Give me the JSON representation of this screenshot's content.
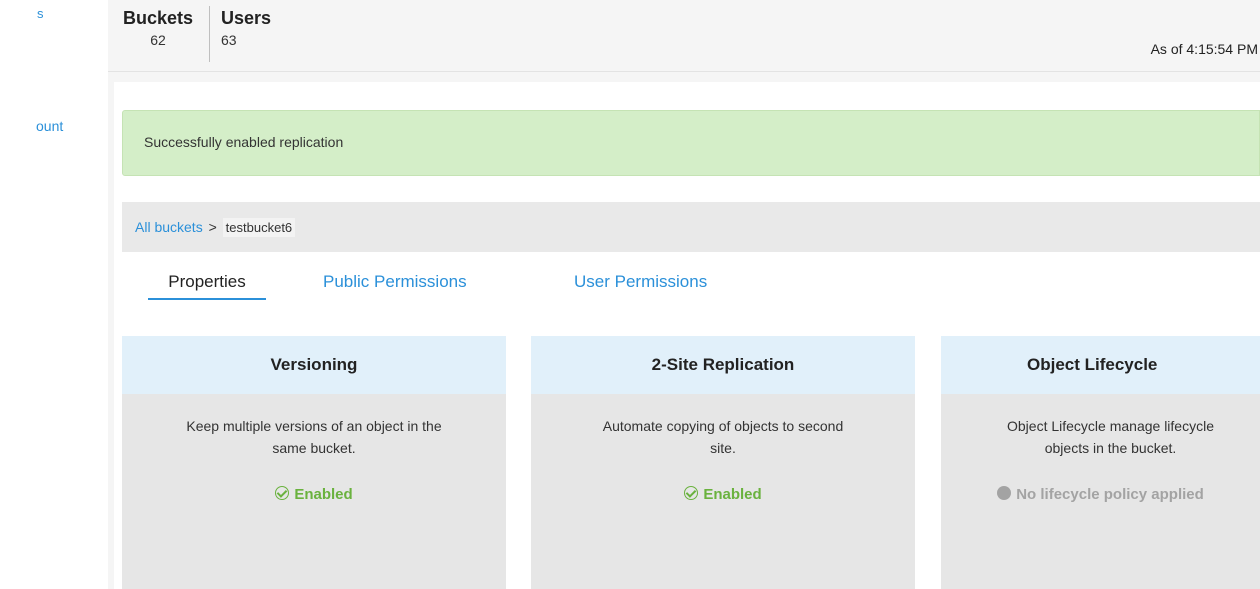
{
  "sidebar": {
    "top_link": "s",
    "account_link": "ount"
  },
  "stats": {
    "buckets_label": "Buckets",
    "buckets_value": "62",
    "users_label": "Users",
    "users_value": "63",
    "as_of": "As of 4:15:54 PM"
  },
  "alert": {
    "message": "Successfully enabled replication"
  },
  "breadcrumb": {
    "root": "All buckets",
    "separator": ">",
    "current": "testbucket6"
  },
  "tabs": [
    {
      "label": "Properties",
      "active": true
    },
    {
      "label": "Public Permissions",
      "active": false
    },
    {
      "label": "User Permissions",
      "active": false
    }
  ],
  "cards": [
    {
      "title": "Versioning",
      "description_line1": "Keep multiple versions of an object in the",
      "description_line2": "same bucket.",
      "status": "Enabled",
      "status_icon": "check-circle-icon"
    },
    {
      "title": "2-Site Replication",
      "description_line1": "Automate copying of objects to second",
      "description_line2": "site.",
      "status": "Enabled",
      "status_icon": "check-circle-icon"
    },
    {
      "title": "Object Lifecycle",
      "description_line1": "Object Lifecycle manage lifecycle",
      "description_line2": "objects in the bucket.",
      "status": "No lifecycle policy applied",
      "status_icon": "grey-dot-icon"
    }
  ],
  "colors": {
    "link": "#2b90d9",
    "enabled": "#6ab23e",
    "disabled": "#a3a3a3",
    "alert_bg": "#d4eec8",
    "card_head_bg": "#e1f0fa"
  }
}
